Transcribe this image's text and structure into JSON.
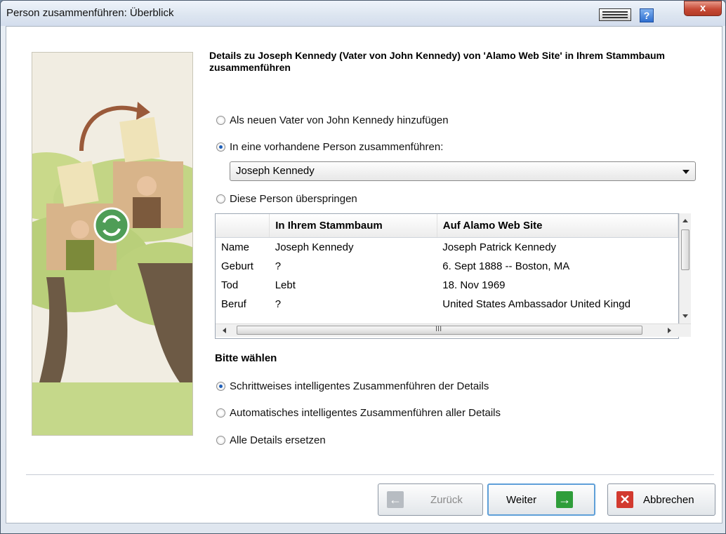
{
  "window": {
    "title": "Person zusammenführen: Überblick",
    "help_label": "?",
    "close_label": "x"
  },
  "heading": "Details zu Joseph Kennedy (Vater von John Kennedy) von 'Alamo Web Site' in Ihrem Stammbaum zusammenführen",
  "options": {
    "add_new": "Als neuen Vater von John Kennedy hinzufügen",
    "merge_existing": "In eine vorhandene Person zusammenführen:",
    "skip": "Diese Person überspringen",
    "selected": "merge_existing"
  },
  "person_select": {
    "value": "Joseph Kennedy"
  },
  "compare_table": {
    "columns": [
      "",
      "In Ihrem Stammbaum",
      "Auf Alamo Web Site"
    ],
    "rows": [
      [
        "Name",
        "Joseph Kennedy",
        "Joseph Patrick Kennedy"
      ],
      [
        "Geburt",
        "?",
        "6. Sept 1888 -- Boston, MA"
      ],
      [
        "Tod",
        "Lebt",
        "18. Nov 1969"
      ],
      [
        "Beruf",
        "?",
        "United States Ambassador United Kingd"
      ]
    ],
    "hscroll_grip": "III"
  },
  "merge_method": {
    "title": "Bitte wählen",
    "stepwise": "Schrittweises intelligentes Zusammenführen der Details",
    "automatic": "Automatisches intelligentes Zusammenführen aller Details",
    "replace_all": "Alle Details ersetzen",
    "selected": "stepwise"
  },
  "buttons": {
    "back": "Zurück",
    "next": "Weiter",
    "cancel": "Abbrechen",
    "back_enabled": false
  },
  "colors": {
    "accent": "#1f5fb8",
    "next_icon": "#2f9d3a",
    "cancel_icon": "#d23a2f"
  }
}
